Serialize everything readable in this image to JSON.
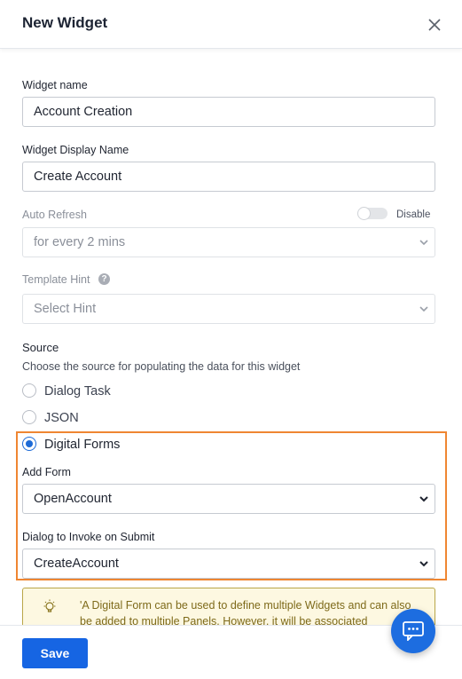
{
  "header": {
    "title": "New Widget"
  },
  "widget_name": {
    "label": "Widget name",
    "value": "Account Creation"
  },
  "display_name": {
    "label": "Widget Display Name",
    "value": "Create Account"
  },
  "auto_refresh": {
    "label": "Auto Refresh",
    "toggle_label": "Disable",
    "enabled": false,
    "selected": "for every 2 mins"
  },
  "template_hint": {
    "label": "Template Hint",
    "placeholder": "Select Hint"
  },
  "source": {
    "label": "Source",
    "description": "Choose the source for populating the data for this widget",
    "options": [
      {
        "label": "Dialog Task",
        "checked": false
      },
      {
        "label": "JSON",
        "checked": false
      },
      {
        "label": "Digital Forms",
        "checked": true
      }
    ]
  },
  "add_form": {
    "label": "Add Form",
    "selected": "OpenAccount"
  },
  "dialog_submit": {
    "label": "Dialog to Invoke on Submit",
    "selected": "CreateAccount"
  },
  "info": {
    "text": "'A Digital Form can be used to define multiple Widgets and can also be added to multiple Panels. However, it will be associated"
  },
  "footer": {
    "save_label": "Save"
  },
  "colors": {
    "accent": "#1665e3",
    "highlight": "#ef8632",
    "info_bg": "#fdf8e1"
  }
}
